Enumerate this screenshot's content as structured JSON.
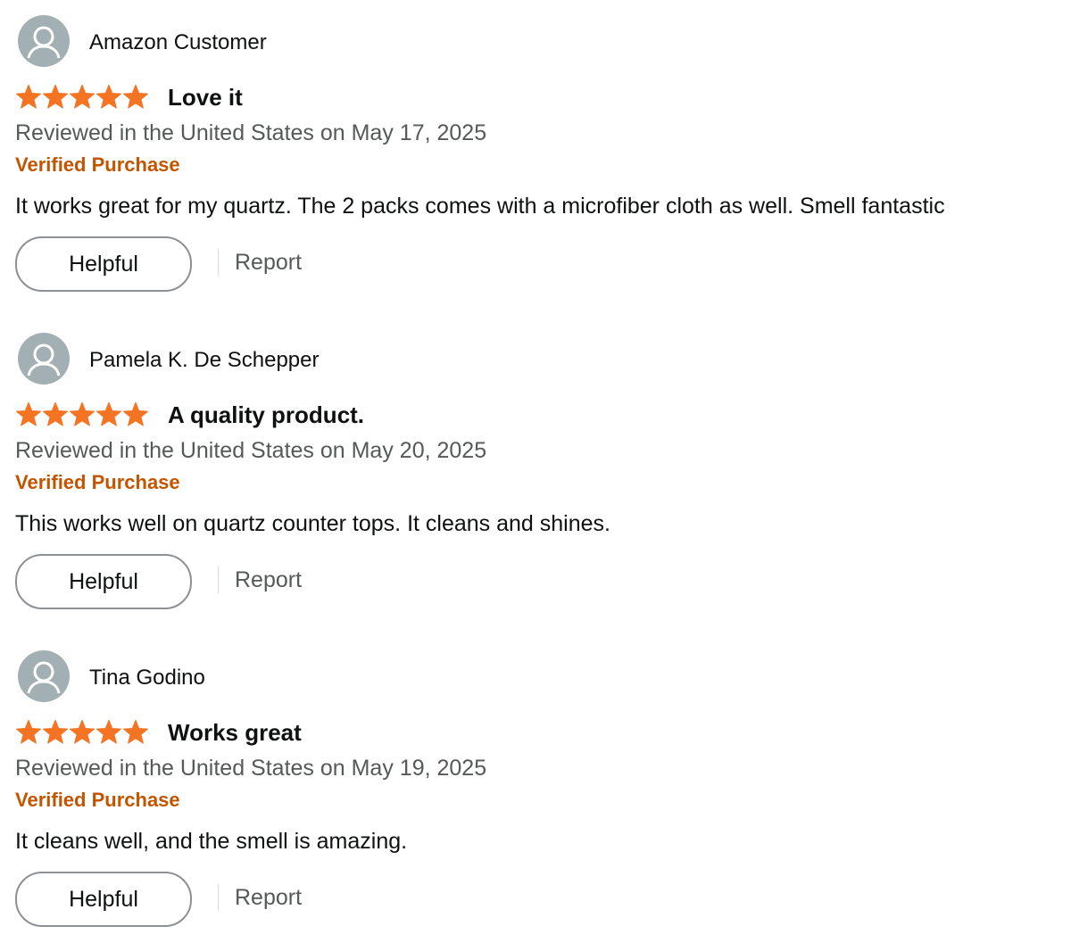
{
  "reviews": [
    {
      "reviewer_name": "Amazon Customer",
      "rating": 5,
      "max_rating": 5,
      "title": "Love it",
      "date": "Reviewed in the United States on May 17, 2025",
      "verified": "Verified Purchase",
      "body": "It works great for my quartz. The 2 packs comes with a microfiber cloth as well. Smell fantastic",
      "helpful_label": "Helpful",
      "report_label": "Report"
    },
    {
      "reviewer_name": "Pamela K. De Schepper",
      "rating": 5,
      "max_rating": 5,
      "title": "A quality product.",
      "date": "Reviewed in the United States on May 20, 2025",
      "verified": "Verified Purchase",
      "body": "This works well on quartz counter tops. It cleans and shines.",
      "helpful_label": "Helpful",
      "report_label": "Report"
    },
    {
      "reviewer_name": "Tina Godino",
      "rating": 5,
      "max_rating": 5,
      "title": "Works great",
      "date": "Reviewed in the United States on May 19, 2025",
      "verified": "Verified Purchase",
      "body": "It cleans well, and the smell is amazing.",
      "helpful_label": "Helpful",
      "report_label": "Report"
    }
  ],
  "colors": {
    "star": "#f47424",
    "verified": "#c45500",
    "avatar_bg": "#a3b0b3",
    "secondary_text": "#565959"
  },
  "icons": {
    "avatar": "default-user-avatar-icon",
    "star": "filled-star-icon"
  }
}
